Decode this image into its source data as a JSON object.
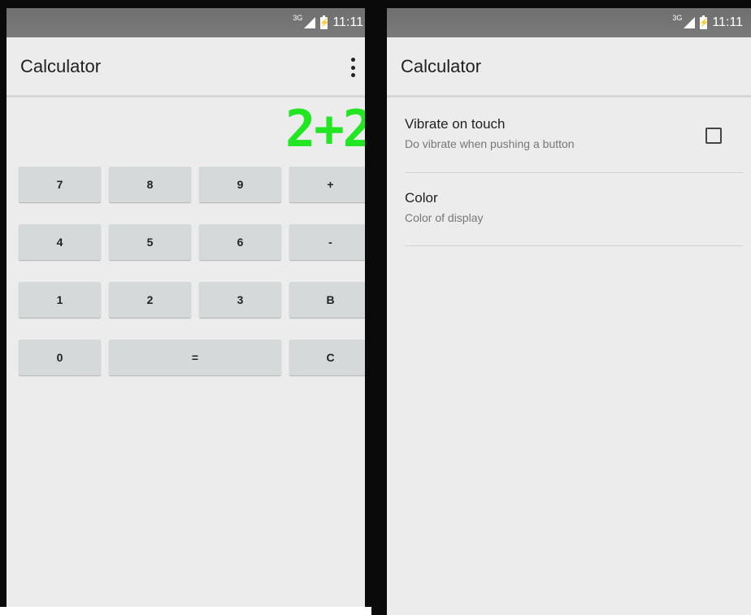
{
  "left_screen": {
    "status": {
      "network": "3G",
      "time": "11:11"
    },
    "app_title": "Calculator",
    "display_text": "2+2",
    "keys": [
      "7",
      "8",
      "9",
      "+",
      "4",
      "5",
      "6",
      "-",
      "1",
      "2",
      "3",
      "B",
      "0",
      "=",
      "C"
    ]
  },
  "right_screen": {
    "status": {
      "network": "3G",
      "time": "11:11"
    },
    "app_title": "Calculator",
    "preferences": [
      {
        "title": "Vibrate on touch",
        "summary": "Do vibrate when pushing a button",
        "checked": false
      },
      {
        "title": "Color",
        "summary": "Color of display"
      }
    ]
  },
  "colors": {
    "display_digits": "#22e622",
    "background": "#ececec",
    "key_background": "#d5d9da"
  }
}
